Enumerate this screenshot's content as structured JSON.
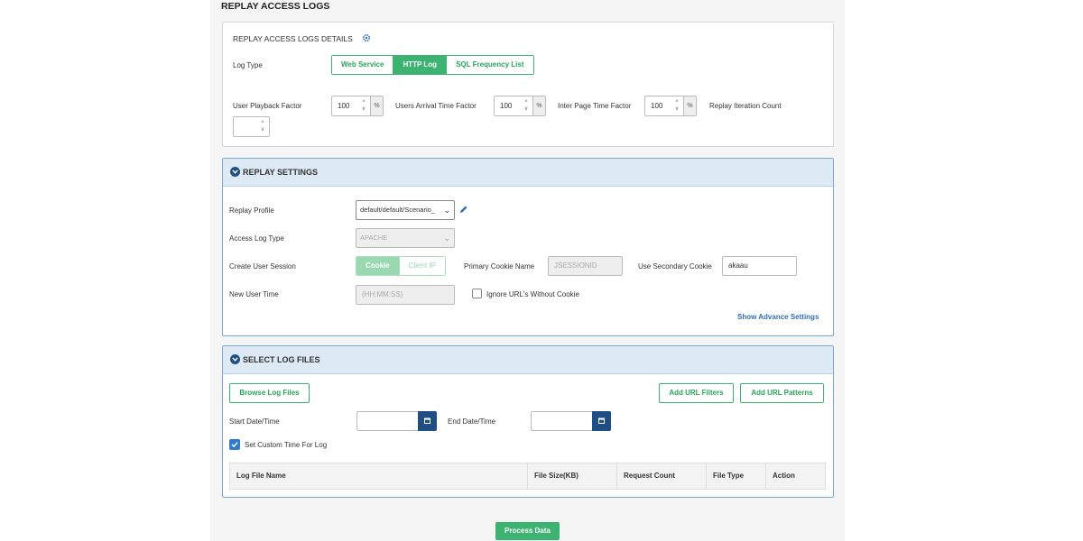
{
  "page_title": "REPLAY ACCESS LOGS",
  "details": {
    "title": "REPLAY ACCESS LOGS DETAILS",
    "log_type_label": "Log Type",
    "log_types": [
      {
        "label": "Web Service",
        "active": false
      },
      {
        "label": "HTTP Log",
        "active": true
      },
      {
        "label": "SQL Frequency List",
        "active": false
      }
    ],
    "user_playback_factor_label": "User Playback Factor",
    "user_playback_factor_value": "100",
    "users_arrival_label": "Users Arrival Time Factor",
    "users_arrival_value": "100",
    "inter_page_label": "Inter Page Time Factor",
    "inter_page_value": "100",
    "percent": "%",
    "iteration_label": "Replay Iteration Count",
    "iteration_value": ""
  },
  "replay_settings": {
    "title": "REPLAY SETTINGS",
    "profile_label": "Replay Profile",
    "profile_value": "default/default/Scenario_",
    "access_log_type_label": "Access Log Type",
    "access_log_type_value": "APACHE",
    "create_session_label": "Create User Session",
    "session_options": [
      {
        "label": "Cookie",
        "active": true
      },
      {
        "label": "Client IP",
        "active": false
      }
    ],
    "primary_cookie_label": "Primary Cookie Name",
    "primary_cookie_value": "JSESSIONID",
    "secondary_cookie_label": "Use Secondary Cookie",
    "secondary_cookie_value": "akaau",
    "new_user_time_label": "New User Time",
    "new_user_time_placeholder": "(HH:MM:SS)",
    "ignore_urls_label": "Ignore URL's Without Cookie",
    "advance_link": "Show Advance Settings"
  },
  "select_log_files": {
    "title": "SELECT LOG FILES",
    "browse_button": "Browse Log Files",
    "add_filters_button": "Add URL Filters",
    "add_patterns_button": "Add URL Patterns",
    "start_label": "Start Date/Time",
    "end_label": "End Date/Time",
    "custom_time_label": "Set Custom Time For Log",
    "custom_time_checked": true,
    "columns": [
      "Log File Name",
      "File Size(KB)",
      "Request Count",
      "File Type",
      "Action"
    ]
  },
  "process_button": "Process Data",
  "colors": {
    "accent_green": "#3cb371",
    "header_blue": "#dde9f5",
    "icon_navy": "#1f4e85",
    "link_blue": "#2f6db5"
  }
}
